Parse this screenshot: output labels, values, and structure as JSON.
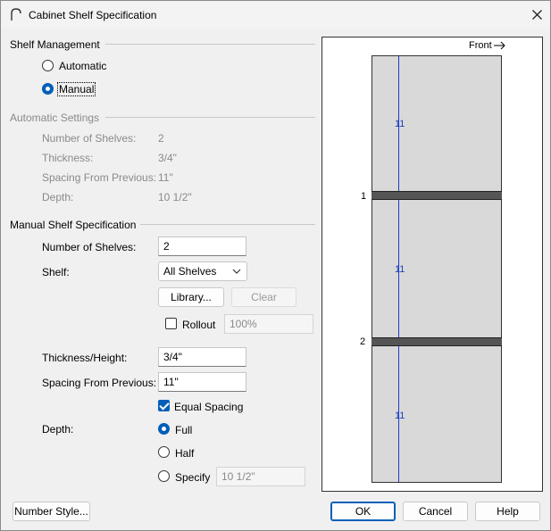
{
  "window": {
    "title": "Cabinet Shelf Specification"
  },
  "shelf_management": {
    "title": "Shelf Management",
    "automatic_label": "Automatic",
    "manual_label": "Manual",
    "selected": "Manual"
  },
  "automatic_settings": {
    "title": "Automatic Settings",
    "num_shelves_label": "Number of Shelves:",
    "num_shelves_value": "2",
    "thickness_label": "Thickness:",
    "thickness_value": "3/4\"",
    "spacing_label": "Spacing From Previous:",
    "spacing_value": "11\"",
    "depth_label": "Depth:",
    "depth_value": "10 1/2\""
  },
  "manual_spec": {
    "title": "Manual Shelf Specification",
    "num_shelves_label": "Number of Shelves:",
    "num_shelves_value": "2",
    "shelf_label": "Shelf:",
    "shelf_selected": "All Shelves",
    "library_button": "Library...",
    "clear_button": "Clear",
    "rollout_label": "Rollout",
    "rollout_checked": false,
    "rollout_value": "100%",
    "thickness_label": "Thickness/Height:",
    "thickness_value": "3/4\"",
    "spacing_label": "Spacing From Previous:",
    "spacing_value": "11\"",
    "equal_spacing_label": "Equal Spacing",
    "equal_spacing_checked": true,
    "depth_label": "Depth:",
    "depth_full": "Full",
    "depth_half": "Half",
    "depth_specify": "Specify",
    "depth_selected": "Full",
    "depth_specify_value": "10 1/2\""
  },
  "preview": {
    "front_label": "Front",
    "shelf_numbers": [
      "1",
      "2"
    ],
    "dimensions": [
      "11",
      "11",
      "11"
    ],
    "colors": {
      "cabinet": "#d9d9d9",
      "shelf": "#555555",
      "dimension": "#1f3fbf"
    }
  },
  "footer": {
    "number_style_button": "Number Style...",
    "ok_button": "OK",
    "cancel_button": "Cancel",
    "help_button": "Help"
  },
  "icons": {
    "app": "cabinet-arch-icon",
    "close": "close-icon",
    "dropdown": "chevron-down-icon",
    "arrow": "arrow-right-icon"
  }
}
